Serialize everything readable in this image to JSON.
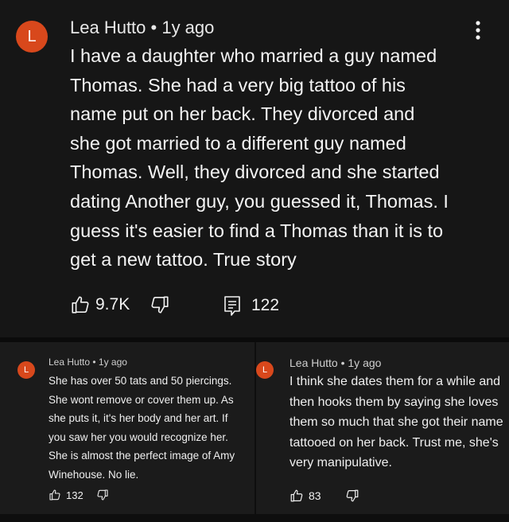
{
  "main_comment": {
    "avatar_letter": "L",
    "meta": "Lea Hutto • 1y ago",
    "body_lines": [
      "I have a daughter who married a guy named",
      "Thomas. She had a very big tattoo of his",
      "name put on her back.  They divorced and",
      "she got married to a different guy named",
      "Thomas. Well, they divorced and she started",
      "dating Another guy, you guessed it, Thomas.  I",
      "guess it's easier to find a Thomas than it is to",
      "get a new tattoo. True story"
    ],
    "likes": "9.7K",
    "replies": "122",
    "icons": {
      "like": "thumbs-up-icon",
      "dislike": "thumbs-down-icon",
      "reply": "reply-comment-icon",
      "menu": "more-vertical-icon"
    }
  },
  "replies": [
    {
      "avatar_letter": "L",
      "meta": "Lea Hutto • 1y ago",
      "body_lines": [
        "She has over 50 tats and 50 piercings.",
        "She wont remove or cover them up. As",
        "she puts it, it's her body and her art. If",
        "you saw her you would recognize her.",
        "She is almost the perfect image of Amy",
        "Winehouse. No lie."
      ],
      "likes": "132"
    },
    {
      "avatar_letter": "L",
      "meta": "Lea Hutto • 1y ago",
      "body_lines": [
        "I think she dates them for a while and",
        "then hooks them by saying she loves",
        "them so much that she got their name",
        "tattooed on her back. Trust me,  she's",
        "very manipulative."
      ],
      "likes": "83"
    }
  ],
  "colors": {
    "avatar": "#d8481c",
    "background": "#161616",
    "card_background": "#1b1b1b",
    "text": "#f4f4f4"
  }
}
